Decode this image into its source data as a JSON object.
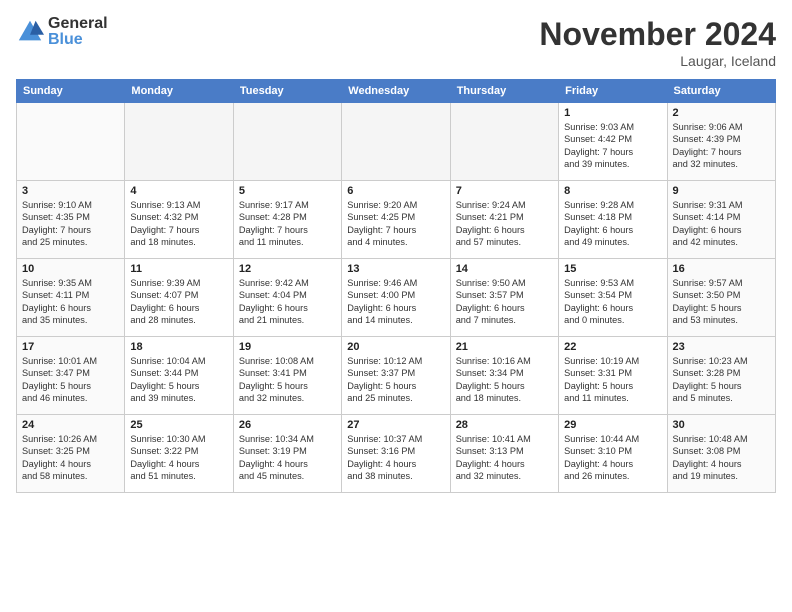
{
  "logo": {
    "general": "General",
    "blue": "Blue"
  },
  "title": "November 2024",
  "location": "Laugar, Iceland",
  "days_of_week": [
    "Sunday",
    "Monday",
    "Tuesday",
    "Wednesday",
    "Thursday",
    "Friday",
    "Saturday"
  ],
  "weeks": [
    [
      {
        "day": "",
        "info": ""
      },
      {
        "day": "",
        "info": ""
      },
      {
        "day": "",
        "info": ""
      },
      {
        "day": "",
        "info": ""
      },
      {
        "day": "",
        "info": ""
      },
      {
        "day": "1",
        "info": "Sunrise: 9:03 AM\nSunset: 4:42 PM\nDaylight: 7 hours\nand 39 minutes."
      },
      {
        "day": "2",
        "info": "Sunrise: 9:06 AM\nSunset: 4:39 PM\nDaylight: 7 hours\nand 32 minutes."
      }
    ],
    [
      {
        "day": "3",
        "info": "Sunrise: 9:10 AM\nSunset: 4:35 PM\nDaylight: 7 hours\nand 25 minutes."
      },
      {
        "day": "4",
        "info": "Sunrise: 9:13 AM\nSunset: 4:32 PM\nDaylight: 7 hours\nand 18 minutes."
      },
      {
        "day": "5",
        "info": "Sunrise: 9:17 AM\nSunset: 4:28 PM\nDaylight: 7 hours\nand 11 minutes."
      },
      {
        "day": "6",
        "info": "Sunrise: 9:20 AM\nSunset: 4:25 PM\nDaylight: 7 hours\nand 4 minutes."
      },
      {
        "day": "7",
        "info": "Sunrise: 9:24 AM\nSunset: 4:21 PM\nDaylight: 6 hours\nand 57 minutes."
      },
      {
        "day": "8",
        "info": "Sunrise: 9:28 AM\nSunset: 4:18 PM\nDaylight: 6 hours\nand 49 minutes."
      },
      {
        "day": "9",
        "info": "Sunrise: 9:31 AM\nSunset: 4:14 PM\nDaylight: 6 hours\nand 42 minutes."
      }
    ],
    [
      {
        "day": "10",
        "info": "Sunrise: 9:35 AM\nSunset: 4:11 PM\nDaylight: 6 hours\nand 35 minutes."
      },
      {
        "day": "11",
        "info": "Sunrise: 9:39 AM\nSunset: 4:07 PM\nDaylight: 6 hours\nand 28 minutes."
      },
      {
        "day": "12",
        "info": "Sunrise: 9:42 AM\nSunset: 4:04 PM\nDaylight: 6 hours\nand 21 minutes."
      },
      {
        "day": "13",
        "info": "Sunrise: 9:46 AM\nSunset: 4:00 PM\nDaylight: 6 hours\nand 14 minutes."
      },
      {
        "day": "14",
        "info": "Sunrise: 9:50 AM\nSunset: 3:57 PM\nDaylight: 6 hours\nand 7 minutes."
      },
      {
        "day": "15",
        "info": "Sunrise: 9:53 AM\nSunset: 3:54 PM\nDaylight: 6 hours\nand 0 minutes."
      },
      {
        "day": "16",
        "info": "Sunrise: 9:57 AM\nSunset: 3:50 PM\nDaylight: 5 hours\nand 53 minutes."
      }
    ],
    [
      {
        "day": "17",
        "info": "Sunrise: 10:01 AM\nSunset: 3:47 PM\nDaylight: 5 hours\nand 46 minutes."
      },
      {
        "day": "18",
        "info": "Sunrise: 10:04 AM\nSunset: 3:44 PM\nDaylight: 5 hours\nand 39 minutes."
      },
      {
        "day": "19",
        "info": "Sunrise: 10:08 AM\nSunset: 3:41 PM\nDaylight: 5 hours\nand 32 minutes."
      },
      {
        "day": "20",
        "info": "Sunrise: 10:12 AM\nSunset: 3:37 PM\nDaylight: 5 hours\nand 25 minutes."
      },
      {
        "day": "21",
        "info": "Sunrise: 10:16 AM\nSunset: 3:34 PM\nDaylight: 5 hours\nand 18 minutes."
      },
      {
        "day": "22",
        "info": "Sunrise: 10:19 AM\nSunset: 3:31 PM\nDaylight: 5 hours\nand 11 minutes."
      },
      {
        "day": "23",
        "info": "Sunrise: 10:23 AM\nSunset: 3:28 PM\nDaylight: 5 hours\nand 5 minutes."
      }
    ],
    [
      {
        "day": "24",
        "info": "Sunrise: 10:26 AM\nSunset: 3:25 PM\nDaylight: 4 hours\nand 58 minutes."
      },
      {
        "day": "25",
        "info": "Sunrise: 10:30 AM\nSunset: 3:22 PM\nDaylight: 4 hours\nand 51 minutes."
      },
      {
        "day": "26",
        "info": "Sunrise: 10:34 AM\nSunset: 3:19 PM\nDaylight: 4 hours\nand 45 minutes."
      },
      {
        "day": "27",
        "info": "Sunrise: 10:37 AM\nSunset: 3:16 PM\nDaylight: 4 hours\nand 38 minutes."
      },
      {
        "day": "28",
        "info": "Sunrise: 10:41 AM\nSunset: 3:13 PM\nDaylight: 4 hours\nand 32 minutes."
      },
      {
        "day": "29",
        "info": "Sunrise: 10:44 AM\nSunset: 3:10 PM\nDaylight: 4 hours\nand 26 minutes."
      },
      {
        "day": "30",
        "info": "Sunrise: 10:48 AM\nSunset: 3:08 PM\nDaylight: 4 hours\nand 19 minutes."
      }
    ]
  ]
}
